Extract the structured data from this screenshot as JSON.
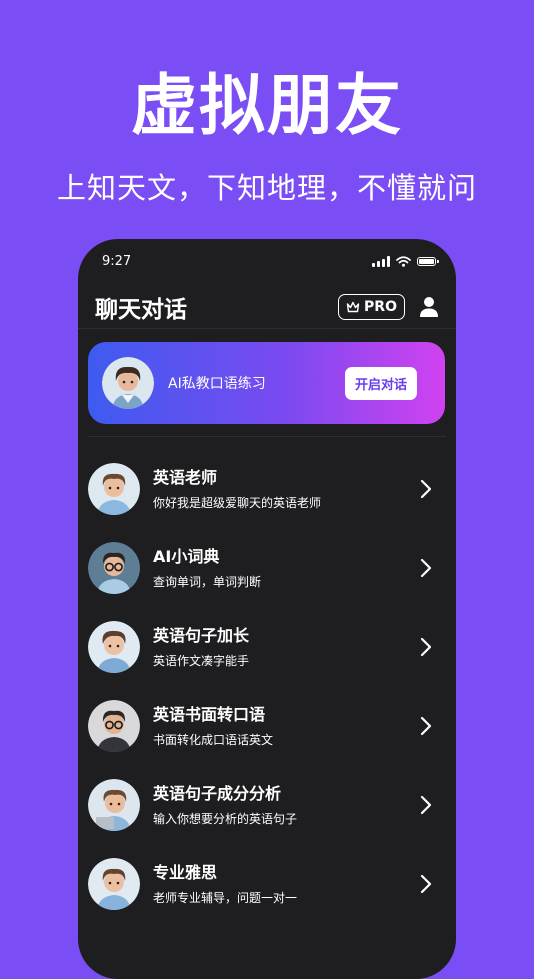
{
  "hero": {
    "title": "虚拟朋友",
    "subtitle": "上知天文，下知地理，不懂就问"
  },
  "status_bar": {
    "time": "9:27"
  },
  "header": {
    "title": "聊天对话",
    "pro_label": "PRO"
  },
  "banner": {
    "label": "AI私教口语练习",
    "button": "开启对话"
  },
  "chats": [
    {
      "title": "英语老师",
      "subtitle": "你好我是超级爱聊天的英语老师"
    },
    {
      "title": "AI小词典",
      "subtitle": "查询单词，单词判断"
    },
    {
      "title": "英语句子加长",
      "subtitle": "英语作文凑字能手"
    },
    {
      "title": "英语书面转口语",
      "subtitle": "书面转化成口语话英文"
    },
    {
      "title": "英语句子成分分析",
      "subtitle": "输入你想要分析的英语句子"
    },
    {
      "title": "专业雅思",
      "subtitle": "老师专业辅导，问题一对一"
    }
  ],
  "colors": {
    "background": "#7B4DF5",
    "phone": "#1E1E21",
    "banner_start": "#3E5BF0",
    "banner_end": "#D142F0"
  }
}
